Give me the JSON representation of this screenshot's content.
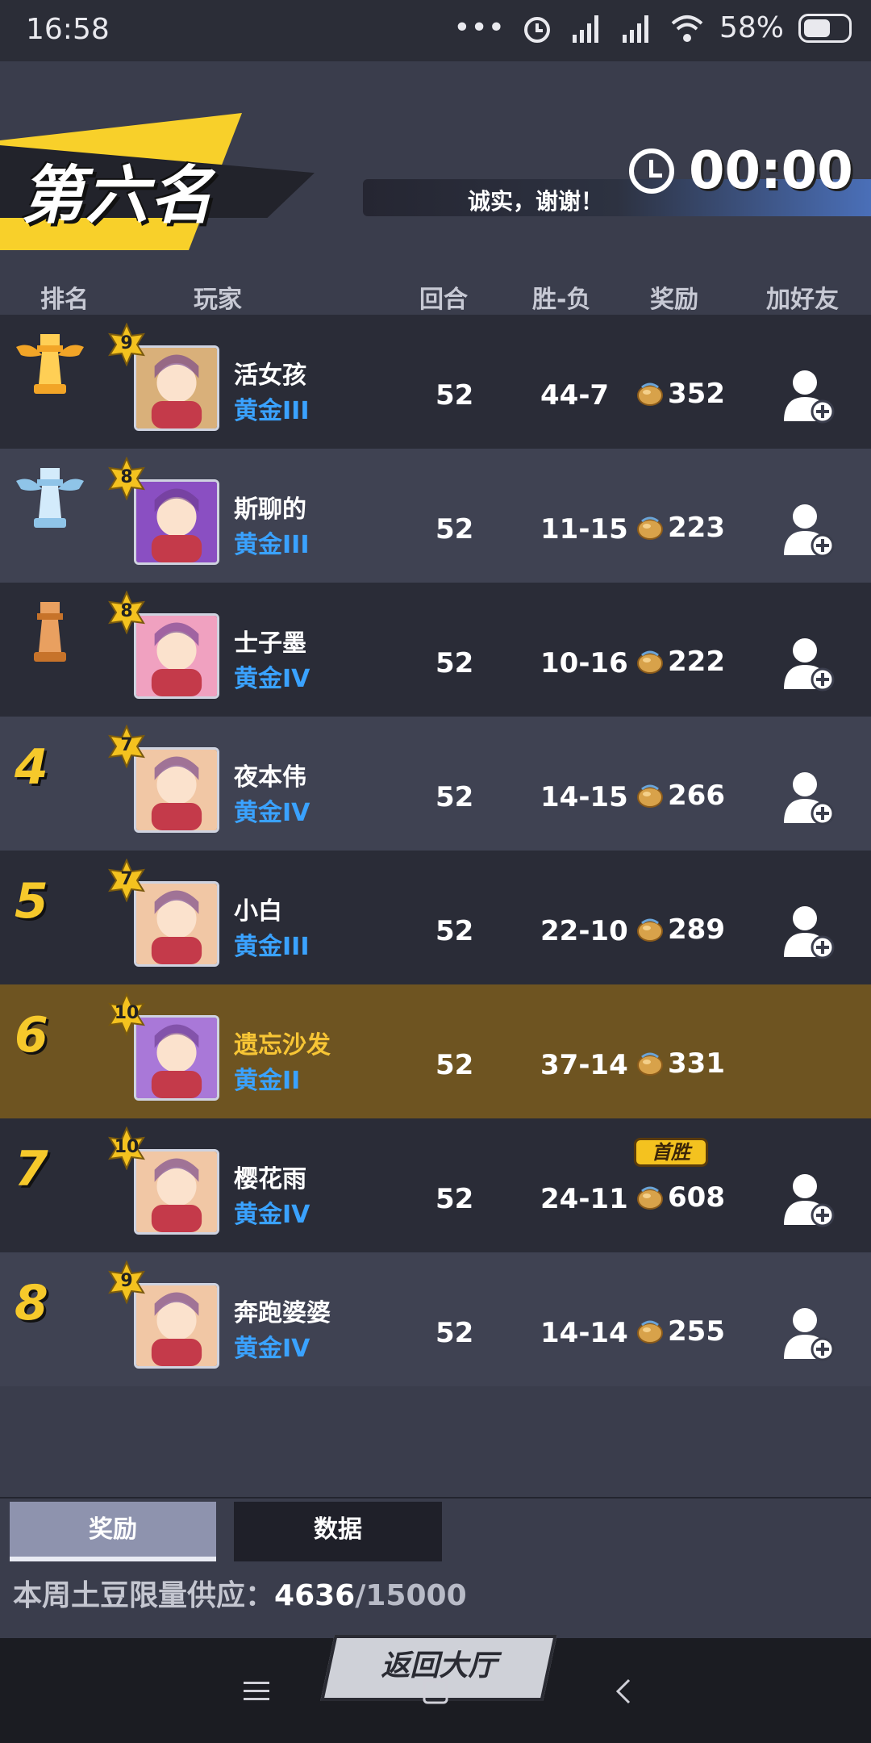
{
  "status_bar": {
    "time": "16:58",
    "dots": "•••",
    "battery": "58%",
    "icons": [
      "alarm-icon",
      "signal-icon",
      "signal-icon",
      "wifi-icon",
      "battery-icon"
    ]
  },
  "banner": {
    "title": "第六名"
  },
  "timer": {
    "value": "00:00"
  },
  "marquee": {
    "text": "诚实，谢谢！"
  },
  "table": {
    "headers": {
      "rank": "排名",
      "player": "玩家",
      "round": "回合",
      "win_loss": "胜-负",
      "reward": "奖励",
      "add_friend": "加好友"
    },
    "rows": [
      {
        "rank": "1",
        "level": "9",
        "name": "活女孩",
        "tier": "黄金III",
        "round": "52",
        "wl": "44-7",
        "reward": "352"
      },
      {
        "rank": "2",
        "level": "8",
        "name": "斯聊的",
        "tier": "黄金III",
        "round": "52",
        "wl": "11-15",
        "reward": "223"
      },
      {
        "rank": "3",
        "level": "8",
        "name": "士子墨",
        "tier": "黄金IV",
        "round": "52",
        "wl": "10-16",
        "reward": "222"
      },
      {
        "rank": "4",
        "level": "7",
        "name": "夜本伟",
        "tier": "黄金IV",
        "round": "52",
        "wl": "14-15",
        "reward": "266"
      },
      {
        "rank": "5",
        "level": "7",
        "name": "小白",
        "tier": "黄金III",
        "round": "52",
        "wl": "22-10",
        "reward": "289"
      },
      {
        "rank": "6",
        "level": "10",
        "name": "遗忘沙发",
        "tier": "黄金II",
        "round": "52",
        "wl": "37-14",
        "reward": "331"
      },
      {
        "rank": "7",
        "level": "10",
        "name": "樱花雨",
        "tier": "黄金IV",
        "round": "52",
        "wl": "24-11",
        "reward": "608",
        "badge": "首胜"
      },
      {
        "rank": "8",
        "level": "9",
        "name": "奔跑婆婆",
        "tier": "黄金IV",
        "round": "52",
        "wl": "14-14",
        "reward": "255"
      }
    ]
  },
  "tabs": {
    "reward": "奖励",
    "data": "数据"
  },
  "supply": {
    "label": "本周土豆限量供应：",
    "current": "4636",
    "max": "/15000"
  },
  "lobby_button": "返回大厅",
  "colors": {
    "accent_yellow": "#f6c92b",
    "tier_blue": "#3aa2ff",
    "highlight_row": "#6e5421"
  }
}
